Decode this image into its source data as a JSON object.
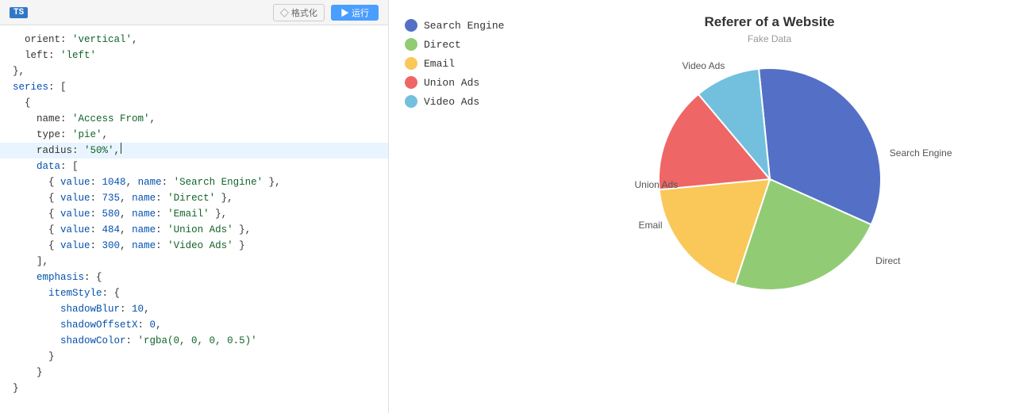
{
  "toolbar": {
    "ts_label": "TS",
    "format_label": "◇ 格式化",
    "run_label": "▶ 运行"
  },
  "chart": {
    "title": "Referer of a Website",
    "subtitle": "Fake Data",
    "legend": [
      {
        "name": "Search Engine",
        "color": "#5470c6"
      },
      {
        "name": "Direct",
        "color": "#91cc75"
      },
      {
        "name": "Email",
        "color": "#fac858"
      },
      {
        "name": "Union Ads",
        "color": "#ee6666"
      },
      {
        "name": "Video Ads",
        "color": "#73c0de"
      }
    ],
    "data": [
      {
        "name": "Search Engine",
        "value": 1048,
        "color": "#5470c6"
      },
      {
        "name": "Direct",
        "value": 735,
        "color": "#91cc75"
      },
      {
        "name": "Email",
        "value": 580,
        "color": "#fac858"
      },
      {
        "name": "Union Ads",
        "value": 484,
        "color": "#ee6666"
      },
      {
        "name": "Video Ads",
        "value": 300,
        "color": "#73c0de"
      }
    ],
    "labels": {
      "search_engine": "Search Engine",
      "direct": "Direct",
      "email": "Email",
      "union_ads": "Union Ads",
      "video_ads": "Video Ads"
    }
  }
}
